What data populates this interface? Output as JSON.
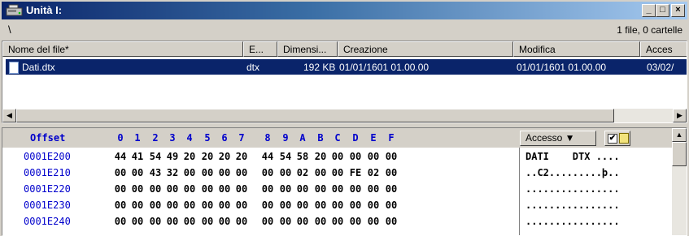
{
  "window": {
    "title": "Unità I:",
    "icon": "drive-icon",
    "buttons": {
      "minimize": "_",
      "maximize": "□",
      "close": "×"
    }
  },
  "pathbar": {
    "path": "\\",
    "count": "1 file, 0 cartelle"
  },
  "file_list": {
    "columns": [
      "Nome del file*",
      "E...",
      "Dimensi...",
      "Creazione",
      "Modifica",
      "Acces"
    ],
    "rows": [
      {
        "name": "Dati.dtx",
        "ext": "dtx",
        "size": "192 KB",
        "created": "01/01/1601  01.00.00",
        "modified": "01/01/1601  01.00.00",
        "accessed": "03/02/"
      }
    ],
    "selected_row": 0
  },
  "hex_view": {
    "offset_label": "Offset",
    "column_labels": [
      "0",
      "1",
      "2",
      "3",
      "4",
      "5",
      "6",
      "7",
      "8",
      "9",
      "A",
      "B",
      "C",
      "D",
      "E",
      "F"
    ],
    "access_label": "Accesso ▼",
    "access_checked": "✔",
    "rows": [
      {
        "offset": "0001E200",
        "bytes": [
          "44",
          "41",
          "54",
          "49",
          "20",
          "20",
          "20",
          "20",
          "44",
          "54",
          "58",
          "20",
          "00",
          "00",
          "00",
          "00"
        ],
        "ascii": "DATI    DTX ...."
      },
      {
        "offset": "0001E210",
        "bytes": [
          "00",
          "00",
          "43",
          "32",
          "00",
          "00",
          "00",
          "00",
          "00",
          "00",
          "02",
          "00",
          "00",
          "FE",
          "02",
          "00"
        ],
        "ascii": "..C2.........þ.."
      },
      {
        "offset": "0001E220",
        "bytes": [
          "00",
          "00",
          "00",
          "00",
          "00",
          "00",
          "00",
          "00",
          "00",
          "00",
          "00",
          "00",
          "00",
          "00",
          "00",
          "00"
        ],
        "ascii": "................"
      },
      {
        "offset": "0001E230",
        "bytes": [
          "00",
          "00",
          "00",
          "00",
          "00",
          "00",
          "00",
          "00",
          "00",
          "00",
          "00",
          "00",
          "00",
          "00",
          "00",
          "00"
        ],
        "ascii": "................"
      },
      {
        "offset": "0001E240",
        "bytes": [
          "00",
          "00",
          "00",
          "00",
          "00",
          "00",
          "00",
          "00",
          "00",
          "00",
          "00",
          "00",
          "00",
          "00",
          "00",
          "00"
        ],
        "ascii": "................"
      }
    ]
  },
  "colors": {
    "titlebar_start": "#0a246a",
    "selection": "#0a246a",
    "hex_label": "#0000cc",
    "face": "#d4d0c8"
  }
}
